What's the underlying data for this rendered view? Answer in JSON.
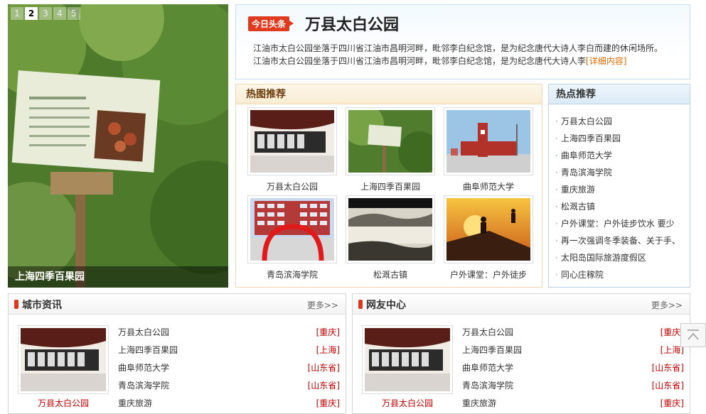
{
  "slider": {
    "numbers": [
      "1",
      "2",
      "3",
      "4",
      "5"
    ],
    "active_index": 1,
    "caption": "上海四季百果园"
  },
  "headline": {
    "badge": "今日头条",
    "title": "万县太白公园",
    "line1": "江油市太白公园坐落于四川省江油市昌明河畔，毗邻李白纪念馆，是为纪念唐代大诗人李白而建的休闲场所。",
    "line2": "江油市太白公园坐落于四川省江油市昌明河畔，毗邻李白纪念馆，是为纪念唐代大诗人李",
    "more": "[详细内容]"
  },
  "hot_images": {
    "title": "热图推荐",
    "items": [
      {
        "label": "万县太白公园"
      },
      {
        "label": "上海四季百果园"
      },
      {
        "label": "曲阜师范大学"
      },
      {
        "label": "青岛滨海学院"
      },
      {
        "label": "松溉古镇"
      },
      {
        "label": "户外课堂：户外徒步"
      }
    ]
  },
  "hot_recommend": {
    "title": "热点推荐",
    "items": [
      "万县太白公园",
      "上海四季百果园",
      "曲阜师范大学",
      "青岛滨海学院",
      "重庆旅游",
      "松溉古镇",
      "户外课堂：户外徒步饮水 要少",
      "再一次强调冬季装备、关于手、",
      "太阳岛国际旅游度假区",
      "同心庄稼院"
    ]
  },
  "city_news": {
    "title": "城市资讯",
    "more": "更多>>",
    "thumb_caption": "万县太白公园",
    "items": [
      {
        "title": "万县太白公园",
        "tag": "[重庆]"
      },
      {
        "title": "上海四季百果园",
        "tag": "[上海]"
      },
      {
        "title": "曲阜师范大学",
        "tag": "[山东省]"
      },
      {
        "title": "青岛滨海学院",
        "tag": "[山东省]"
      },
      {
        "title": "重庆旅游",
        "tag": "[重庆]"
      }
    ]
  },
  "netizen": {
    "title": "网友中心",
    "more": "更多>>",
    "thumb_caption": "万县太白公园",
    "items": [
      {
        "title": "万县太白公园",
        "tag": "[重庆]"
      },
      {
        "title": "上海四季百果园",
        "tag": "[上海]"
      },
      {
        "title": "曲阜师范大学",
        "tag": "[山东省]"
      },
      {
        "title": "青岛滨海学院",
        "tag": "[山东省]"
      },
      {
        "title": "重庆旅游",
        "tag": "[重庆]"
      }
    ]
  }
}
